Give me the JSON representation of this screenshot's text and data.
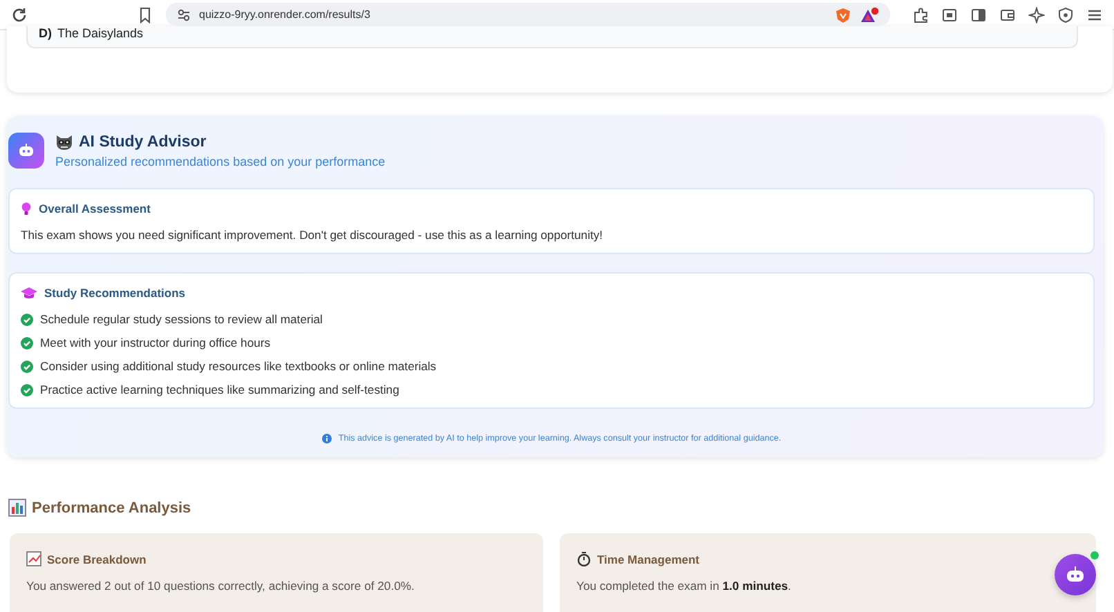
{
  "browser": {
    "url": "quizzo-9ryy.onrender.com/results/3"
  },
  "answer_option": {
    "label": "D)",
    "text": "The Daisylands"
  },
  "advisor": {
    "title": "AI Study Advisor",
    "subtitle": "Personalized recommendations based on your performance",
    "assessment": {
      "title": "Overall Assessment",
      "text": "This exam shows you need significant improvement. Don't get discouraged - use this as a learning opportunity!"
    },
    "recommendations": {
      "title": "Study Recommendations",
      "items": [
        "Schedule regular study sessions to review all material",
        "Meet with your instructor during office hours",
        "Consider using additional study resources like textbooks or online materials",
        "Practice active learning techniques like summarizing and self-testing"
      ]
    },
    "disclaimer": "This advice is generated by AI to help improve your learning. Always consult your instructor for additional guidance."
  },
  "performance": {
    "title": "Performance Analysis",
    "cards": [
      {
        "kind": "score",
        "title": "Score Breakdown",
        "text": "You answered 2 out of 10 questions correctly, achieving a score of 20.0%."
      },
      {
        "kind": "time",
        "title": "Time Management",
        "text": "You completed the exam in **1.0 minutes**."
      }
    ]
  },
  "chat_button": {
    "online": true
  }
}
